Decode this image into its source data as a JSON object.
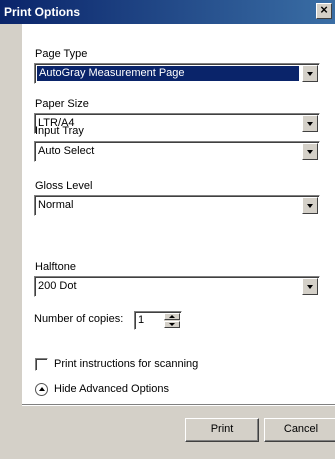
{
  "window": {
    "title": "Print Options",
    "close_glyph": "×"
  },
  "fields": [
    {
      "label": "Page Type",
      "value": "AutoGray Measurement Page"
    },
    {
      "label": "Paper Size",
      "value": "LTR/A4"
    },
    {
      "label": "Input Tray",
      "value": "Auto Select"
    },
    {
      "label": "Gloss Level",
      "value": "Normal"
    },
    {
      "label": "Halftone",
      "value": "200 Dot"
    }
  ],
  "copies": {
    "label": "Number of copies:",
    "value": "1"
  },
  "scan_instructions": {
    "label": "Print instructions for scanning",
    "checked": false
  },
  "advanced_toggle": {
    "label": "Hide Advanced Options",
    "icon": "chevron-up-icon"
  },
  "buttons": {
    "print": "Print",
    "cancel": "Cancel"
  },
  "colors": {
    "title_bar": "#0a246a",
    "selection": "#0a246a",
    "dialog_bg": "#d4d0c8"
  }
}
